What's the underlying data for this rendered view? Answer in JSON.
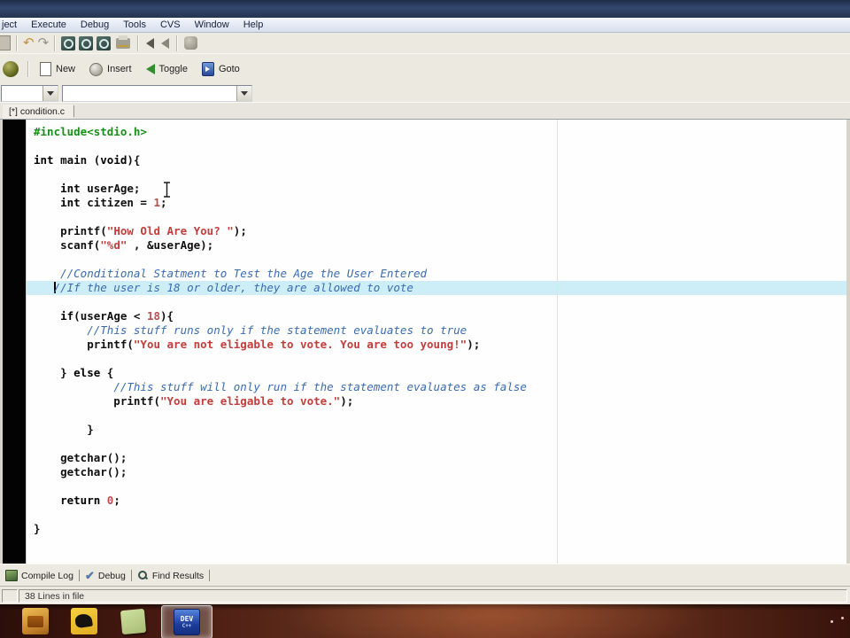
{
  "colors": {
    "plain": "#101010",
    "keyword": "#000000",
    "string": "#c43c3c",
    "comment": "#3a6bb0",
    "include": "#189018",
    "number": "#b85050",
    "line_highlight": "#cdeef7"
  },
  "menubar": {
    "items": [
      {
        "id": "project",
        "label": "ject"
      },
      {
        "id": "execute",
        "label": "Execute"
      },
      {
        "id": "debug",
        "label": "Debug"
      },
      {
        "id": "tools",
        "label": "Tools"
      },
      {
        "id": "cvs",
        "label": "CVS"
      },
      {
        "id": "window",
        "label": "Window"
      },
      {
        "id": "help",
        "label": "Help"
      }
    ]
  },
  "toolbar_bookmarks": {
    "buttons": [
      {
        "id": "new",
        "label": "New"
      },
      {
        "id": "insert",
        "label": "Insert"
      },
      {
        "id": "toggle",
        "label": "Toggle"
      },
      {
        "id": "goto",
        "label": "Goto"
      }
    ]
  },
  "combos": {
    "left": {
      "value": ""
    },
    "right": {
      "value": ""
    }
  },
  "tabbar": {
    "tabs": [
      {
        "label": "[*] condition.c"
      }
    ]
  },
  "editor": {
    "highlight_line": 11,
    "caret": {
      "line": 11,
      "seg": 1
    },
    "lines": [
      [
        {
          "t": "#include<stdio.h>",
          "c": "inc"
        }
      ],
      [],
      [
        {
          "t": "int",
          "c": "kw"
        },
        {
          "t": " main (",
          "c": "pln"
        },
        {
          "t": "void",
          "c": "kw"
        },
        {
          "t": "){",
          "c": "pln"
        }
      ],
      [],
      [
        {
          "t": "    ",
          "c": "pln"
        },
        {
          "t": "int",
          "c": "kw"
        },
        {
          "t": " userAge;",
          "c": "pln"
        }
      ],
      [
        {
          "t": "    ",
          "c": "pln"
        },
        {
          "t": "int",
          "c": "kw"
        },
        {
          "t": " citizen = ",
          "c": "pln"
        },
        {
          "t": "1",
          "c": "num"
        },
        {
          "t": ";",
          "c": "pln"
        }
      ],
      [],
      [
        {
          "t": "    printf(",
          "c": "pln"
        },
        {
          "t": "\"How Old Are You? \"",
          "c": "str"
        },
        {
          "t": ");",
          "c": "pln"
        }
      ],
      [
        {
          "t": "    scanf(",
          "c": "pln"
        },
        {
          "t": "\"%d\"",
          "c": "str"
        },
        {
          "t": " , &userAge);",
          "c": "pln"
        }
      ],
      [],
      [
        {
          "t": "    ",
          "c": "pln"
        },
        {
          "t": "//Conditional Statment to Test the Age the User Entered",
          "c": "com"
        }
      ],
      [
        {
          "t": "   ",
          "c": "pln"
        },
        {
          "t": "//If the user is 18 or older, they are allowed to vote",
          "c": "com"
        }
      ],
      [],
      [
        {
          "t": "    ",
          "c": "pln"
        },
        {
          "t": "if",
          "c": "kw"
        },
        {
          "t": "(userAge < ",
          "c": "pln"
        },
        {
          "t": "18",
          "c": "num"
        },
        {
          "t": "){",
          "c": "pln"
        }
      ],
      [
        {
          "t": "        ",
          "c": "pln"
        },
        {
          "t": "//This stuff runs only if the statement evaluates to true",
          "c": "com"
        }
      ],
      [
        {
          "t": "        printf(",
          "c": "pln"
        },
        {
          "t": "\"You are not eligable to vote. You are too young!\"",
          "c": "str"
        },
        {
          "t": ");",
          "c": "pln"
        }
      ],
      [],
      [
        {
          "t": "    } ",
          "c": "pln"
        },
        {
          "t": "else",
          "c": "kw"
        },
        {
          "t": " {",
          "c": "pln"
        }
      ],
      [
        {
          "t": "            ",
          "c": "pln"
        },
        {
          "t": "//This stuff will only run if the statement evaluates as false",
          "c": "com"
        }
      ],
      [
        {
          "t": "            printf(",
          "c": "pln"
        },
        {
          "t": "\"You are eligable to vote.\"",
          "c": "str"
        },
        {
          "t": ");",
          "c": "pln"
        }
      ],
      [],
      [
        {
          "t": "        }",
          "c": "pln"
        }
      ],
      [],
      [
        {
          "t": "    getchar();",
          "c": "pln"
        }
      ],
      [
        {
          "t": "    getchar();",
          "c": "pln"
        }
      ],
      [],
      [
        {
          "t": "    ",
          "c": "pln"
        },
        {
          "t": "return",
          "c": "kw"
        },
        {
          "t": " ",
          "c": "pln"
        },
        {
          "t": "0",
          "c": "num"
        },
        {
          "t": ";",
          "c": "pln"
        }
      ],
      [],
      [
        {
          "t": "}",
          "c": "pln"
        }
      ]
    ]
  },
  "bottom_panel": {
    "tabs": [
      {
        "id": "compile-log",
        "label": "Compile Log"
      },
      {
        "id": "debug",
        "label": "Debug"
      },
      {
        "id": "find-results",
        "label": "Find Results"
      }
    ],
    "check_glyph": "✔"
  },
  "statusbar": {
    "text": "38 Lines in file"
  },
  "taskbar": {
    "dev_icon": {
      "label": "DEV",
      "sublabel": "C++"
    }
  }
}
